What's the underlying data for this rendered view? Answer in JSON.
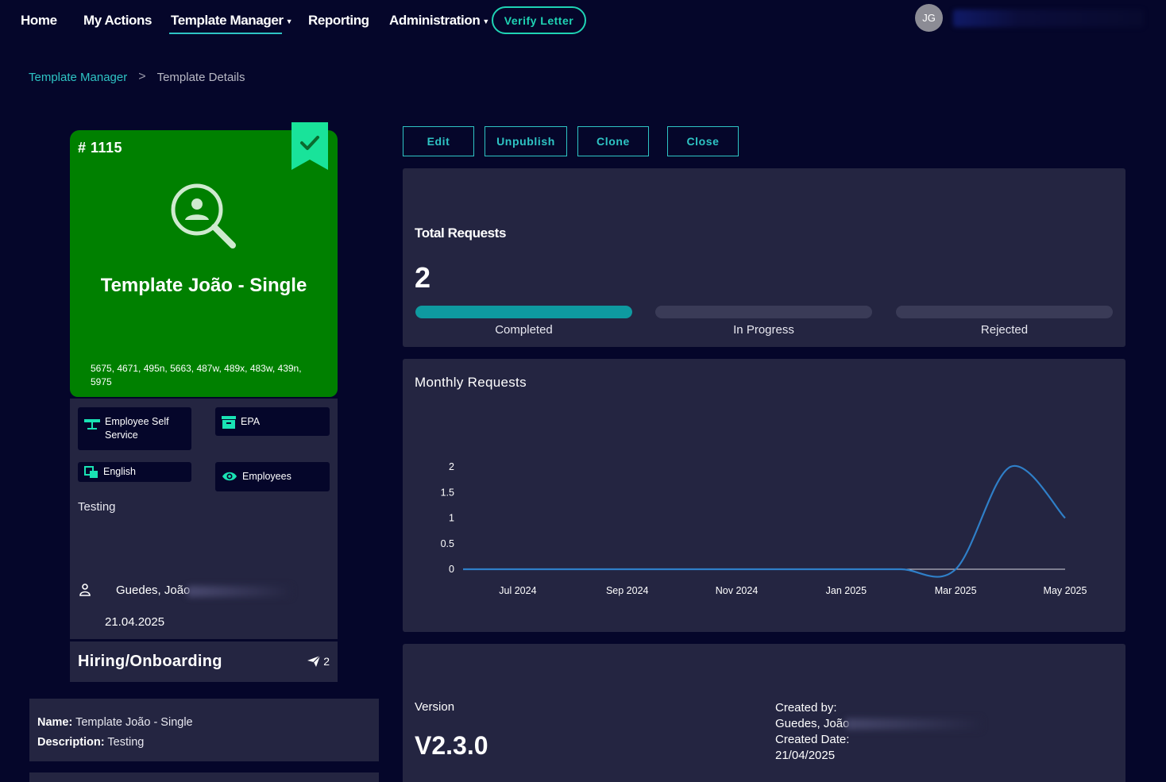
{
  "nav": {
    "items": [
      {
        "label": "Home",
        "dropdown": false
      },
      {
        "label": "My Actions",
        "dropdown": false
      },
      {
        "label": "Template Manager",
        "dropdown": true,
        "active": true
      },
      {
        "label": "Reporting",
        "dropdown": false
      },
      {
        "label": "Administration",
        "dropdown": true
      }
    ],
    "verify_label": "Verify Letter",
    "user_initials": "JG"
  },
  "breadcrumb": {
    "parent": "Template Manager",
    "separator": ">",
    "current": "Template Details"
  },
  "template": {
    "id_label": "# 1115",
    "name": "Template João - Single",
    "codes": "5675, 4671, 495n, 5663, 487w, 489x, 483w, 439n, 5975",
    "card_color": "#008000",
    "icon": "user-search-icon",
    "published": true,
    "chips": {
      "system": "Employee Self Service",
      "company": "EPA",
      "language": "English",
      "audience": "Employees"
    },
    "description": "Testing",
    "owner": "Guedes, João",
    "date": "21.04.2025",
    "category": "Hiring/Onboarding",
    "sent_count": "2"
  },
  "details": {
    "name_label": "Name:",
    "name_value": "Template João - Single",
    "desc_label": "Description:",
    "desc_value": "Testing"
  },
  "actions": {
    "edit": "Edit",
    "unpublish": "Unpublish",
    "clone": "Clone",
    "close": "Close"
  },
  "requests": {
    "title": "Total Requests",
    "total": "2",
    "bars": [
      {
        "label": "Completed",
        "fraction": 1.0
      },
      {
        "label": "In Progress",
        "fraction": 0.0
      },
      {
        "label": "Rejected",
        "fraction": 0.0
      }
    ],
    "accent": "#0e9aa0"
  },
  "chart_data": {
    "type": "line",
    "title": "Monthly Requests",
    "x": [
      "2024-06",
      "2024-07",
      "2024-08",
      "2024-09",
      "2024-10",
      "2024-11",
      "2024-12",
      "2025-01",
      "2025-02",
      "2025-03",
      "2025-04",
      "2025-05"
    ],
    "x_tick_labels": [
      "Jul 2024",
      "Sep 2024",
      "Nov 2024",
      "Jan 2025",
      "Mar 2025",
      "May 2025"
    ],
    "series": [
      {
        "values": [
          0,
          0,
          0,
          0,
          0,
          0,
          0,
          0,
          0,
          0,
          2,
          1
        ],
        "color": "#2f7fc8"
      }
    ],
    "y_ticks": [
      "0",
      "0.5",
      "1",
      "1.5",
      "2"
    ],
    "ylim": [
      0,
      2
    ],
    "grid": false
  },
  "version": {
    "label": "Version",
    "value": "V2.3.0",
    "created_by_label": "Created by:",
    "created_by": "Guedes, João",
    "created_date_label": "Created Date:",
    "created_date": "21/04/2025"
  }
}
